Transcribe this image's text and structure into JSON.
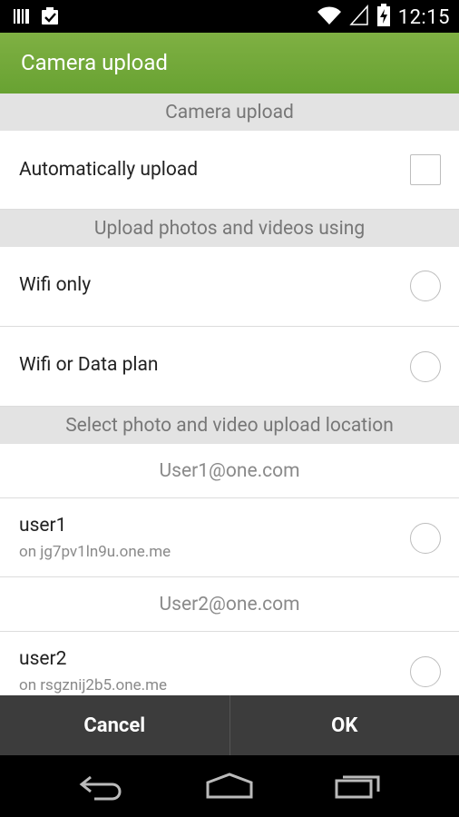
{
  "status_bar": {
    "time": "12:15",
    "icons": [
      "barcode-icon",
      "clipboard-check-icon",
      "wifi-icon",
      "signal-icon",
      "battery-charging-icon"
    ]
  },
  "action_bar": {
    "title": "Camera upload"
  },
  "sections": {
    "camera_upload": {
      "header": "Camera upload",
      "auto_upload_label": "Automatically upload",
      "auto_upload_checked": false
    },
    "network": {
      "header": "Upload photos and videos using",
      "options": [
        {
          "label": "Wifi only",
          "selected": false
        },
        {
          "label": "Wifi or Data plan",
          "selected": false
        }
      ]
    },
    "location": {
      "header": "Select photo and video upload location",
      "accounts": [
        {
          "email": "User1@one.com",
          "name": "user1",
          "host": "on jg7pv1ln9u.one.me",
          "selected": false
        },
        {
          "email": "User2@one.com",
          "name": "user2",
          "host": "on rsgznij2b5.one.me",
          "selected": false
        }
      ]
    }
  },
  "buttons": {
    "cancel": "Cancel",
    "ok": "OK"
  },
  "colors": {
    "action_bar": "#6ea437",
    "button_bar": "#3c3c3c",
    "section_header_bg": "#e3e3e3"
  }
}
